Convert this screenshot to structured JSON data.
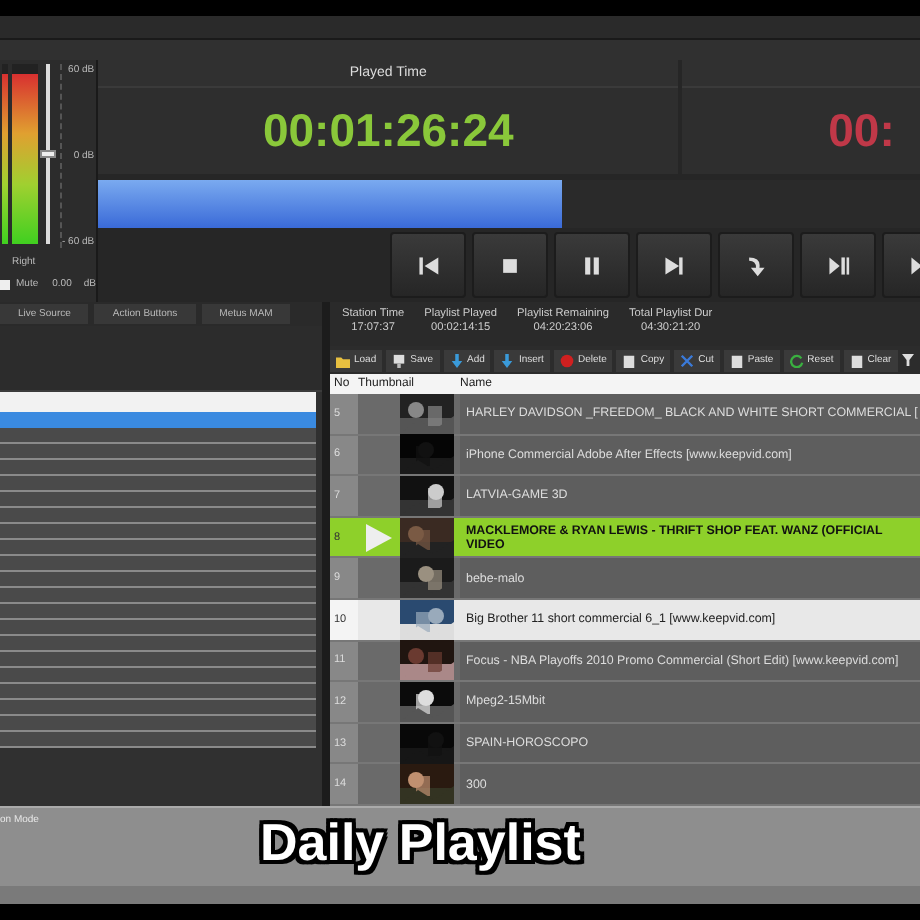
{
  "meter": {
    "channels": [
      {
        "level": 0.95
      },
      {
        "level": 0.95
      }
    ],
    "channel_label": "Right",
    "scale": [
      "60 dB",
      "0 dB",
      "- 60 dB"
    ],
    "volume": {
      "level": 0.5
    },
    "mute": {
      "label": "Mute",
      "checked": false
    },
    "gain": "0.00",
    "unit": "dB"
  },
  "played_time": {
    "title": "Played Time",
    "value": "00:01:26:24"
  },
  "remaining_time": {
    "value": "00:"
  },
  "progress": {
    "level": 0.54
  },
  "left_tabs": [
    {
      "label": "Live Source",
      "selected": false
    },
    {
      "label": "Action Buttons",
      "selected": false
    },
    {
      "label": "Metus MAM",
      "selected": false
    }
  ],
  "left_list": {
    "rows": [
      {
        "selected": true
      },
      {
        "selected": false
      },
      {
        "selected": false
      },
      {
        "selected": false
      },
      {
        "selected": false
      },
      {
        "selected": false
      },
      {
        "selected": false
      },
      {
        "selected": false
      },
      {
        "selected": false
      },
      {
        "selected": false
      },
      {
        "selected": false
      },
      {
        "selected": false
      },
      {
        "selected": false
      },
      {
        "selected": false
      },
      {
        "selected": false
      },
      {
        "selected": false
      },
      {
        "selected": false
      },
      {
        "selected": false
      },
      {
        "selected": false
      },
      {
        "selected": false
      },
      {
        "selected": false
      }
    ]
  },
  "bottom_label": "on Mode",
  "stats": [
    {
      "label": "Station Time",
      "value": "17:07:37"
    },
    {
      "label": "Playlist Played",
      "value": "00:02:14:15"
    },
    {
      "label": "Playlist Remaining",
      "value": "04:20:23:06"
    },
    {
      "label": "Total Playlist Dur",
      "value": "04:30:21:20"
    }
  ],
  "toolbar": [
    "Load",
    "Save",
    "Add",
    "Insert",
    "Delete",
    "Copy",
    "Cut",
    "Paste",
    "Reset",
    "Clear"
  ],
  "table": {
    "columns": [
      "No",
      "Thumbnail",
      "Name"
    ],
    "rows": [
      {
        "no": "5",
        "name": "HARLEY DAVIDSON _FREEDOM_ BLACK AND WHITE SHORT COMMERCIAL [",
        "playing": false,
        "selected": false
      },
      {
        "no": "6",
        "name": "iPhone Commercial Adobe After Effects [www.keepvid.com]",
        "playing": false,
        "selected": false
      },
      {
        "no": "7",
        "name": "LATVIA-GAME 3D",
        "playing": false,
        "selected": false
      },
      {
        "no": "8",
        "name": "MACKLEMORE & RYAN LEWIS - THRIFT SHOP FEAT. WANZ (OFFICIAL VIDEO",
        "playing": true,
        "selected": false
      },
      {
        "no": "9",
        "name": "bebe-malo",
        "playing": false,
        "selected": false
      },
      {
        "no": "10",
        "name": "Big Brother 11 short commercial 6_1 [www.keepvid.com]",
        "playing": false,
        "selected": true
      },
      {
        "no": "11",
        "name": "Focus - NBA Playoffs 2010 Promo Commercial (Short Edit) [www.keepvid.com]",
        "playing": false,
        "selected": false
      },
      {
        "no": "12",
        "name": "Mpeg2-15Mbit",
        "playing": false,
        "selected": false
      },
      {
        "no": "13",
        "name": "SPAIN-HOROSCOPO",
        "playing": false,
        "selected": false
      },
      {
        "no": "14",
        "name": "300",
        "playing": false,
        "selected": false
      }
    ]
  },
  "caption": "Daily Playlist"
}
